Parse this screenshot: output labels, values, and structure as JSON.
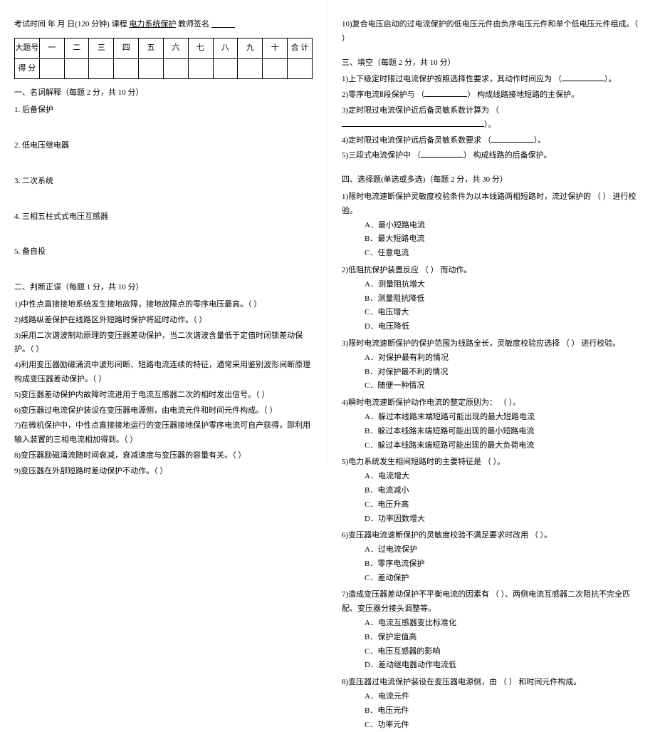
{
  "header": {
    "line": "考试时间    年   月   日(120 分钟)  课程",
    "course": "电力系统保护",
    "sig_label": "   教师签名",
    "sig_blank": "______"
  },
  "score_table": {
    "row1": [
      "大题号",
      "一",
      "二",
      "三",
      "四",
      "五",
      "六",
      "七",
      "八",
      "九",
      "十",
      "合 计"
    ],
    "row2_label": "得 分"
  },
  "sec1": {
    "title": "一、名词解释（每题 2 分，共 10 分）",
    "items": [
      "1. 后备保护",
      "2. 低电压继电器",
      "3. 二次系统",
      "4. 三相五柱式式电压互感器",
      "5. 备自投"
    ]
  },
  "sec2": {
    "title": "二、判断正误（每题 1 分，共 10 分）",
    "items": [
      "1)中性点直接接地系统发生接地故障，接地故障点的零序电压最高。（  ）",
      "2)线路纵差保护在线路区外短路时保护将延时动作。（  ）",
      "3)采用二次谐波制动原理的变压器差动保护，当二次谐波含量低于定值时闭锁差动保护。（  ）",
      "4)利用变压器励磁涌流中波形间断、短路电流连续的特征，通常采用鉴别波形间断原理构成变压器差动保护。（  ）",
      "5)变压器差动保护内故障时流进用于电流互感器二次的相时发出信号。（  ）",
      "6)变压器过电流保护装设在变压器电源侧，由电流元件和时间元件构成。（  ）",
      "7)在微机保护中，中性点直接接地运行的变压器接地保护零序电流可自产获得，即利用输入装置的三相电流相加得到。（  ）",
      "8)变压器励磁涌流随时间衰减，衰减速度与变压器的容量有关。（  ）",
      "9)变压器在外部短路时差动保护不动作。（  ）"
    ]
  },
  "sec2_cont": "10)复合电压启动的过电流保护的低电压元件由负序电压元件和单个低电压元件组成。（  ）",
  "sec3": {
    "title": "三、填空（每题 2 分，共 10 分）",
    "items": [
      {
        "pre": "1)上下级定时限过电流保护按照选择性要求，其动作时间应为 （",
        "post": "）。"
      },
      {
        "pre": "2)零序电流Ⅱ段保护与 （",
        "post": "） 构成线路接地短路的主保护。"
      },
      {
        "pre": "3)定时限过电流保护近后备灵敏系数计算为 （",
        "post": "）。"
      },
      {
        "pre": "4)定时限过电流保护远后备灵敏系数要求 （",
        "post": "）。"
      },
      {
        "pre": "5)三段式电流保护中 （",
        "post": "） 构成线路的后备保护。"
      }
    ]
  },
  "sec4": {
    "title": "四、选择题(单选或多选)（每题 2 分，共 30 分）",
    "q1": {
      "stem": "1)限时电流速断保护灵敏度校验条件为以本线路两相短路时，流过保护的 （   ） 进行校验。",
      "opts": [
        "A．最小短路电流",
        "B．最大短路电流",
        "C．任意电流"
      ]
    },
    "q2": {
      "stem": "2)低阻抗保护装置反应 （   ） 而动作。",
      "opts": [
        "A．测量阻抗增大",
        "B．测量阻抗降低",
        "C．电压增大",
        "D．电压降低"
      ]
    },
    "q3": {
      "stem": "3)限时电流速断保护的保护范围为线路全长，灵敏度校验应选择 （   ） 进行校验。",
      "opts": [
        "A．对保护最有利的情况",
        "B．对保护最不利的情况",
        "C．随便一种情况"
      ]
    },
    "q4": {
      "stem": "4)瞬时电流速断保护动作电流的整定原则为： （  ）。",
      "opts": [
        "A．躲过本线路末端短路可能出现的最大短路电流",
        "B．躲过本线路末端短路可能出现的最小短路电流",
        "C．躲过本线路末端短路可能出现的最大负荷电流"
      ]
    },
    "q5": {
      "stem": "5)电力系统发生相间短路时的主要特征是 （  ）。",
      "opts": [
        "A．电流增大",
        "B．电流减小",
        "C．电压升高",
        "D．功率因数增大"
      ]
    },
    "q6": {
      "stem": "6)变压器电流速断保护的灵敏度校验不满足要求时改用 （   ）。",
      "opts": [
        "A．过电流保护",
        "B．零序电流保护",
        "C．差动保护"
      ]
    },
    "q7": {
      "stem": "7)造成变压器差动保护不平衡电流的因素有 （    ）、两侧电流互感器二次阻抗不完全匹配、变压器分接头调整等。",
      "opts": [
        "A．电流互感器变比标准化",
        "B．保护定值高",
        "C．电压互感器的影响",
        "D．差动继电器动作电流低"
      ]
    },
    "q8": {
      "stem": "8)变压器过电流保护装设在变压器电源侧，由 （   ） 和时间元件构成。",
      "opts": [
        "A．电流元件",
        "B．电压元件",
        "C．功率元件"
      ]
    }
  }
}
